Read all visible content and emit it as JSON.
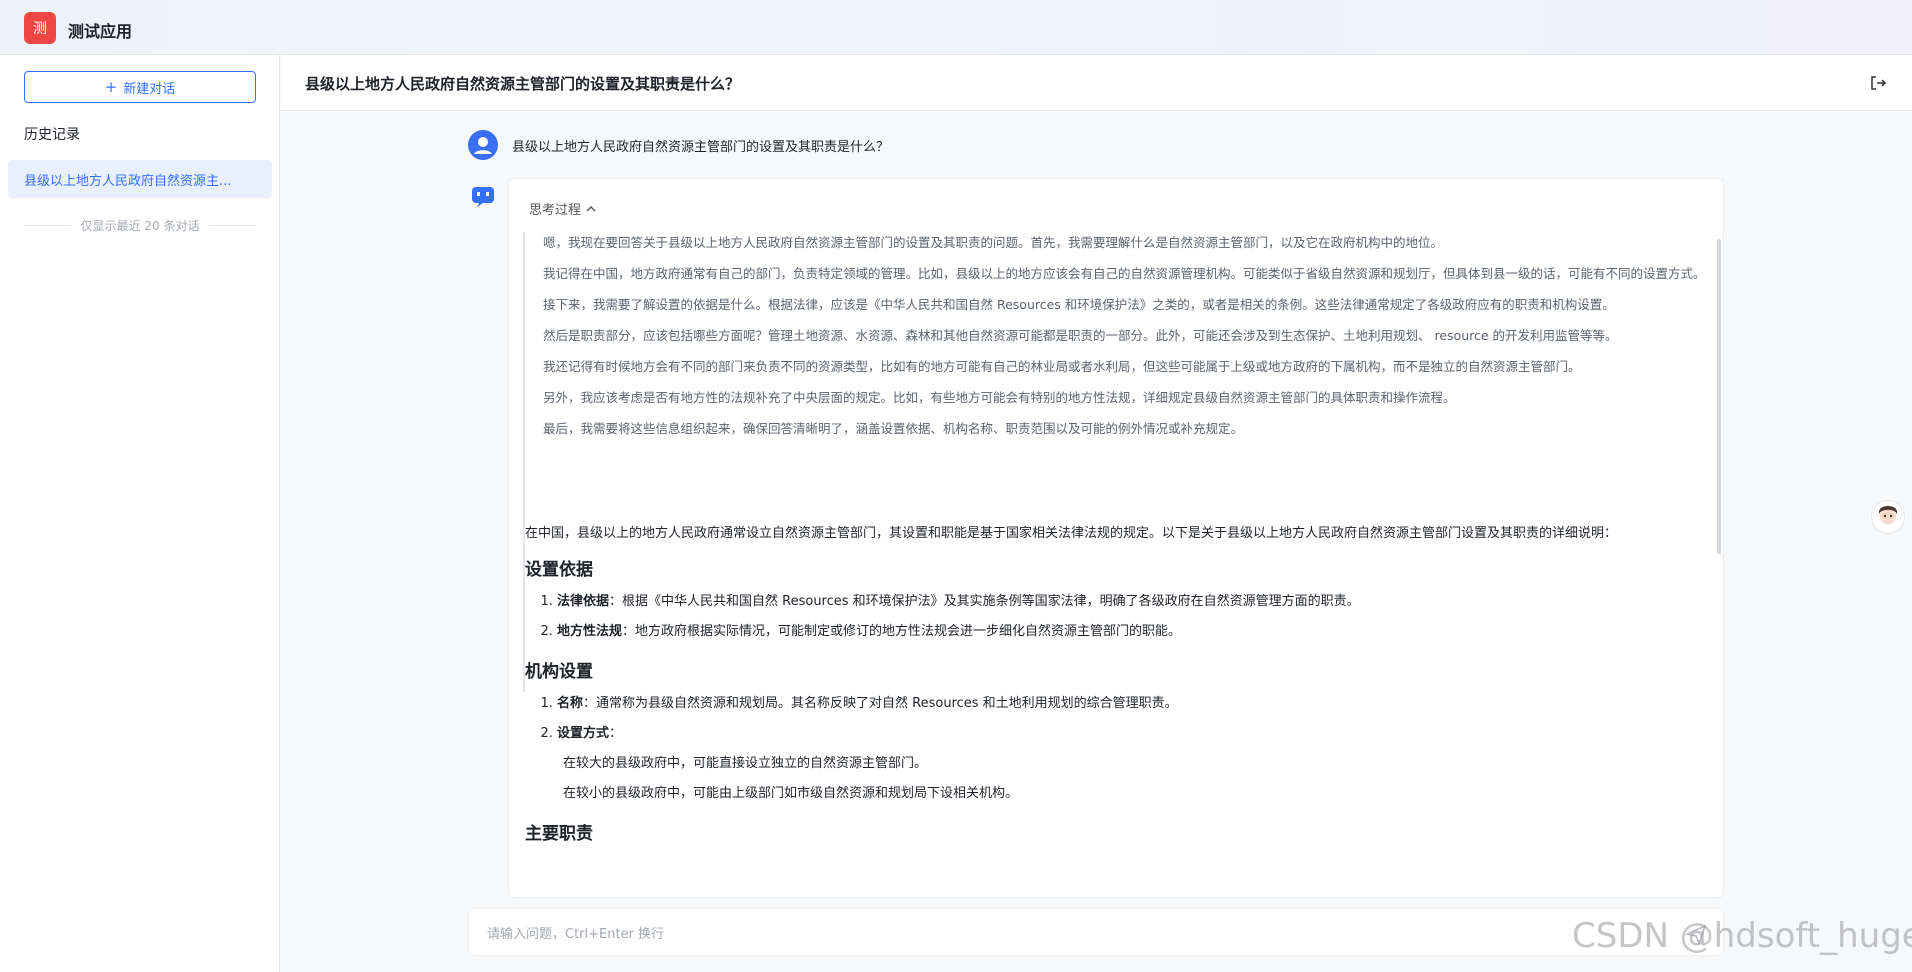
{
  "app": {
    "logo_char": "测",
    "title": "测试应用"
  },
  "sidebar": {
    "new_chat_label": "新建对话",
    "history_title": "历史记录",
    "history_items": [
      {
        "label": "县级以上地方人民政府自然资源主..."
      }
    ],
    "history_note": "仅显示最近 20 条对话"
  },
  "conversation": {
    "title": "县级以上地方人民政府自然资源主管部门的设置及其职责是什么？",
    "user_message": "县级以上地方人民政府自然资源主管部门的设置及其职责是什么？",
    "think_label": "思考过程",
    "think_paragraphs": [
      "嗯，我现在要回答关于县级以上地方人民政府自然资源主管部门的设置及其职责的问题。首先，我需要理解什么是自然资源主管部门，以及它在政府机构中的地位。",
      "我记得在中国，地方政府通常有自己的部门，负责特定领域的管理。比如，县级以上的地方应该会有自己的自然资源管理机构。可能类似于省级自然资源和规划厅，但具体到县一级的话，可能有不同的设置方式。",
      "接下来，我需要了解设置的依据是什么。根据法律，应该是《中华人民共和国自然 Resources 和环境保护法》之类的，或者是相关的条例。这些法律通常规定了各级政府应有的职责和机构设置。",
      "然后是职责部分，应该包括哪些方面呢？管理土地资源、水资源、森林和其他自然资源可能都是职责的一部分。此外，可能还会涉及到生态保护、土地利用规划、 resource 的开发利用监管等等。",
      "我还记得有时候地方会有不同的部门来负责不同的资源类型，比如有的地方可能有自己的林业局或者水利局，但这些可能属于上级或地方政府的下属机构，而不是独立的自然资源主管部门。",
      "另外，我应该考虑是否有地方性的法规补充了中央层面的规定。比如，有些地方可能会有特别的地方性法规，详细规定县级自然资源主管部门的具体职责和操作流程。",
      "最后，我需要将这些信息组织起来，确保回答清晰明了，涵盖设置依据、机构名称、职责范围以及可能的例外情况或补充规定。"
    ],
    "answer": {
      "intro": "在中国，县级以上的地方人民政府通常设立自然资源主管部门，其设置和职能是基于国家相关法律法规的规定。以下是关于县级以上地方人民政府自然资源主管部门设置及其职责的详细说明：",
      "section1": {
        "heading": "设置依据",
        "items": [
          {
            "bold": "法律依据",
            "text": "：根据《中华人民共和国自然 Resources 和环境保护法》及其实施条例等国家法律，明确了各级政府在自然资源管理方面的职责。"
          },
          {
            "bold": "地方性法规",
            "text": "：地方政府根据实际情况，可能制定或修订的地方性法规会进一步细化自然资源主管部门的职能。"
          }
        ]
      },
      "section2": {
        "heading": "机构设置",
        "items": [
          {
            "bold": "名称",
            "text": "：通常称为县级自然资源和规划局。其名称反映了对自然 Resources 和土地利用规划的综合管理职责。"
          },
          {
            "bold": "设置方式",
            "text": "："
          }
        ],
        "sub_items": [
          "在较大的县级政府中，可能直接设立独立的自然资源主管部门。",
          "在较小的县级政府中，可能由上级部门如市级自然资源和规划局下设相关机构。"
        ]
      },
      "section3": {
        "heading": "主要职责"
      }
    }
  },
  "input": {
    "placeholder": "请输入问题，Ctrl+Enter 换行"
  },
  "watermark": "CSDN @hdsoft_huge",
  "colors": {
    "accent": "#3370ff",
    "logo_bg": "#ef4744",
    "user_avatar": "#3a6ff4"
  }
}
